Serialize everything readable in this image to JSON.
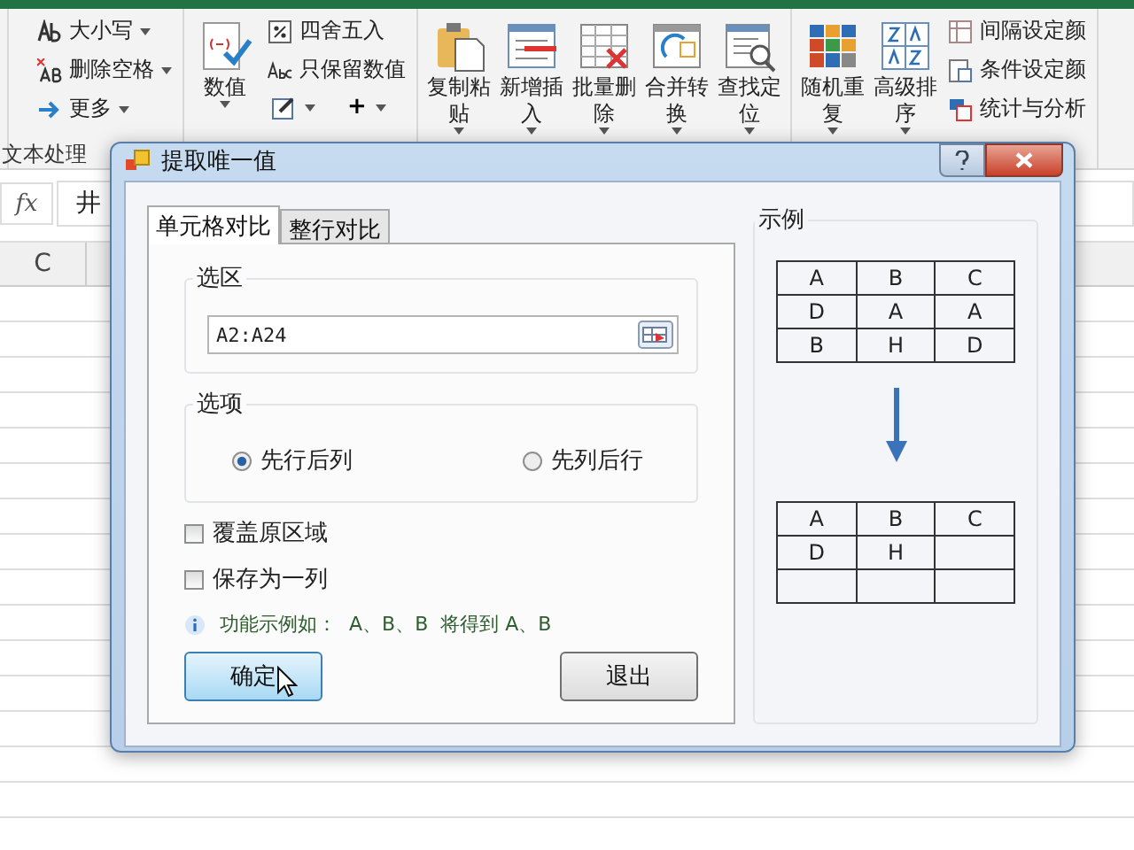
{
  "ribbon": {
    "groups": [
      {
        "label": "文本处理",
        "items": [
          {
            "kind": "small",
            "label": "大小写",
            "dropdown": true
          },
          {
            "kind": "small",
            "label": "删除空格",
            "dropdown": true
          },
          {
            "kind": "small",
            "label": "更多",
            "dropdown": true
          }
        ]
      },
      {
        "items": [
          {
            "kind": "big",
            "label": "数值",
            "dropdown": true
          },
          {
            "kind": "small",
            "label": "四舍五入",
            "dropdown": false
          },
          {
            "kind": "small",
            "label": "只保留数值",
            "dropdown": false
          },
          {
            "kind": "tools",
            "tools": [
              {
                "dropdown": true
              },
              {
                "label": "+",
                "dropdown": true
              }
            ]
          }
        ]
      },
      {
        "items": [
          {
            "kind": "big",
            "label": "复制粘贴",
            "dropdown": true
          },
          {
            "kind": "big",
            "label": "新增插入",
            "dropdown": true
          },
          {
            "kind": "big",
            "label": "批量删除",
            "dropdown": true
          },
          {
            "kind": "big",
            "label": "合并转换",
            "dropdown": true
          },
          {
            "kind": "big",
            "label": "查找定位",
            "dropdown": true
          }
        ]
      },
      {
        "items": [
          {
            "kind": "big",
            "label": "随机重复",
            "dropdown": true
          },
          {
            "kind": "big",
            "label": "高级排序",
            "dropdown": true
          },
          {
            "kind": "small",
            "label": "间隔设定颜",
            "dropdown": false
          },
          {
            "kind": "small",
            "label": "条件设定颜",
            "dropdown": false
          },
          {
            "kind": "small",
            "label": "统计与分析",
            "dropdown": false
          }
        ]
      }
    ]
  },
  "formula_bar": {
    "fx": "fx",
    "value": "井"
  },
  "columns": [
    "C"
  ],
  "dialog": {
    "title": "提取唯一值",
    "tabs": [
      {
        "label": "单元格对比",
        "selected": true
      },
      {
        "label": "整行对比",
        "selected": false
      }
    ],
    "range_group": {
      "label": "选区",
      "value": "A2:A24"
    },
    "options_group": {
      "label": "选项",
      "radios": [
        {
          "label": "先行后列",
          "selected": true
        },
        {
          "label": "先列后行",
          "selected": false
        }
      ]
    },
    "checkboxes": [
      {
        "label": "覆盖原区域",
        "checked": false
      },
      {
        "label": "保存为一列",
        "checked": false
      }
    ],
    "info": "功能示例如：  A、B、B  将得到 A、B",
    "buttons": [
      {
        "label": "确定",
        "kind": "primary"
      },
      {
        "label": "退出",
        "kind": "normal"
      }
    ],
    "example": {
      "label": "示例",
      "before": [
        [
          "A",
          "B",
          "C"
        ],
        [
          "D",
          "A",
          "A"
        ],
        [
          "B",
          "H",
          "D"
        ]
      ],
      "after": [
        [
          "A",
          "B",
          "C"
        ],
        [
          "D",
          "H"
        ]
      ]
    }
  }
}
